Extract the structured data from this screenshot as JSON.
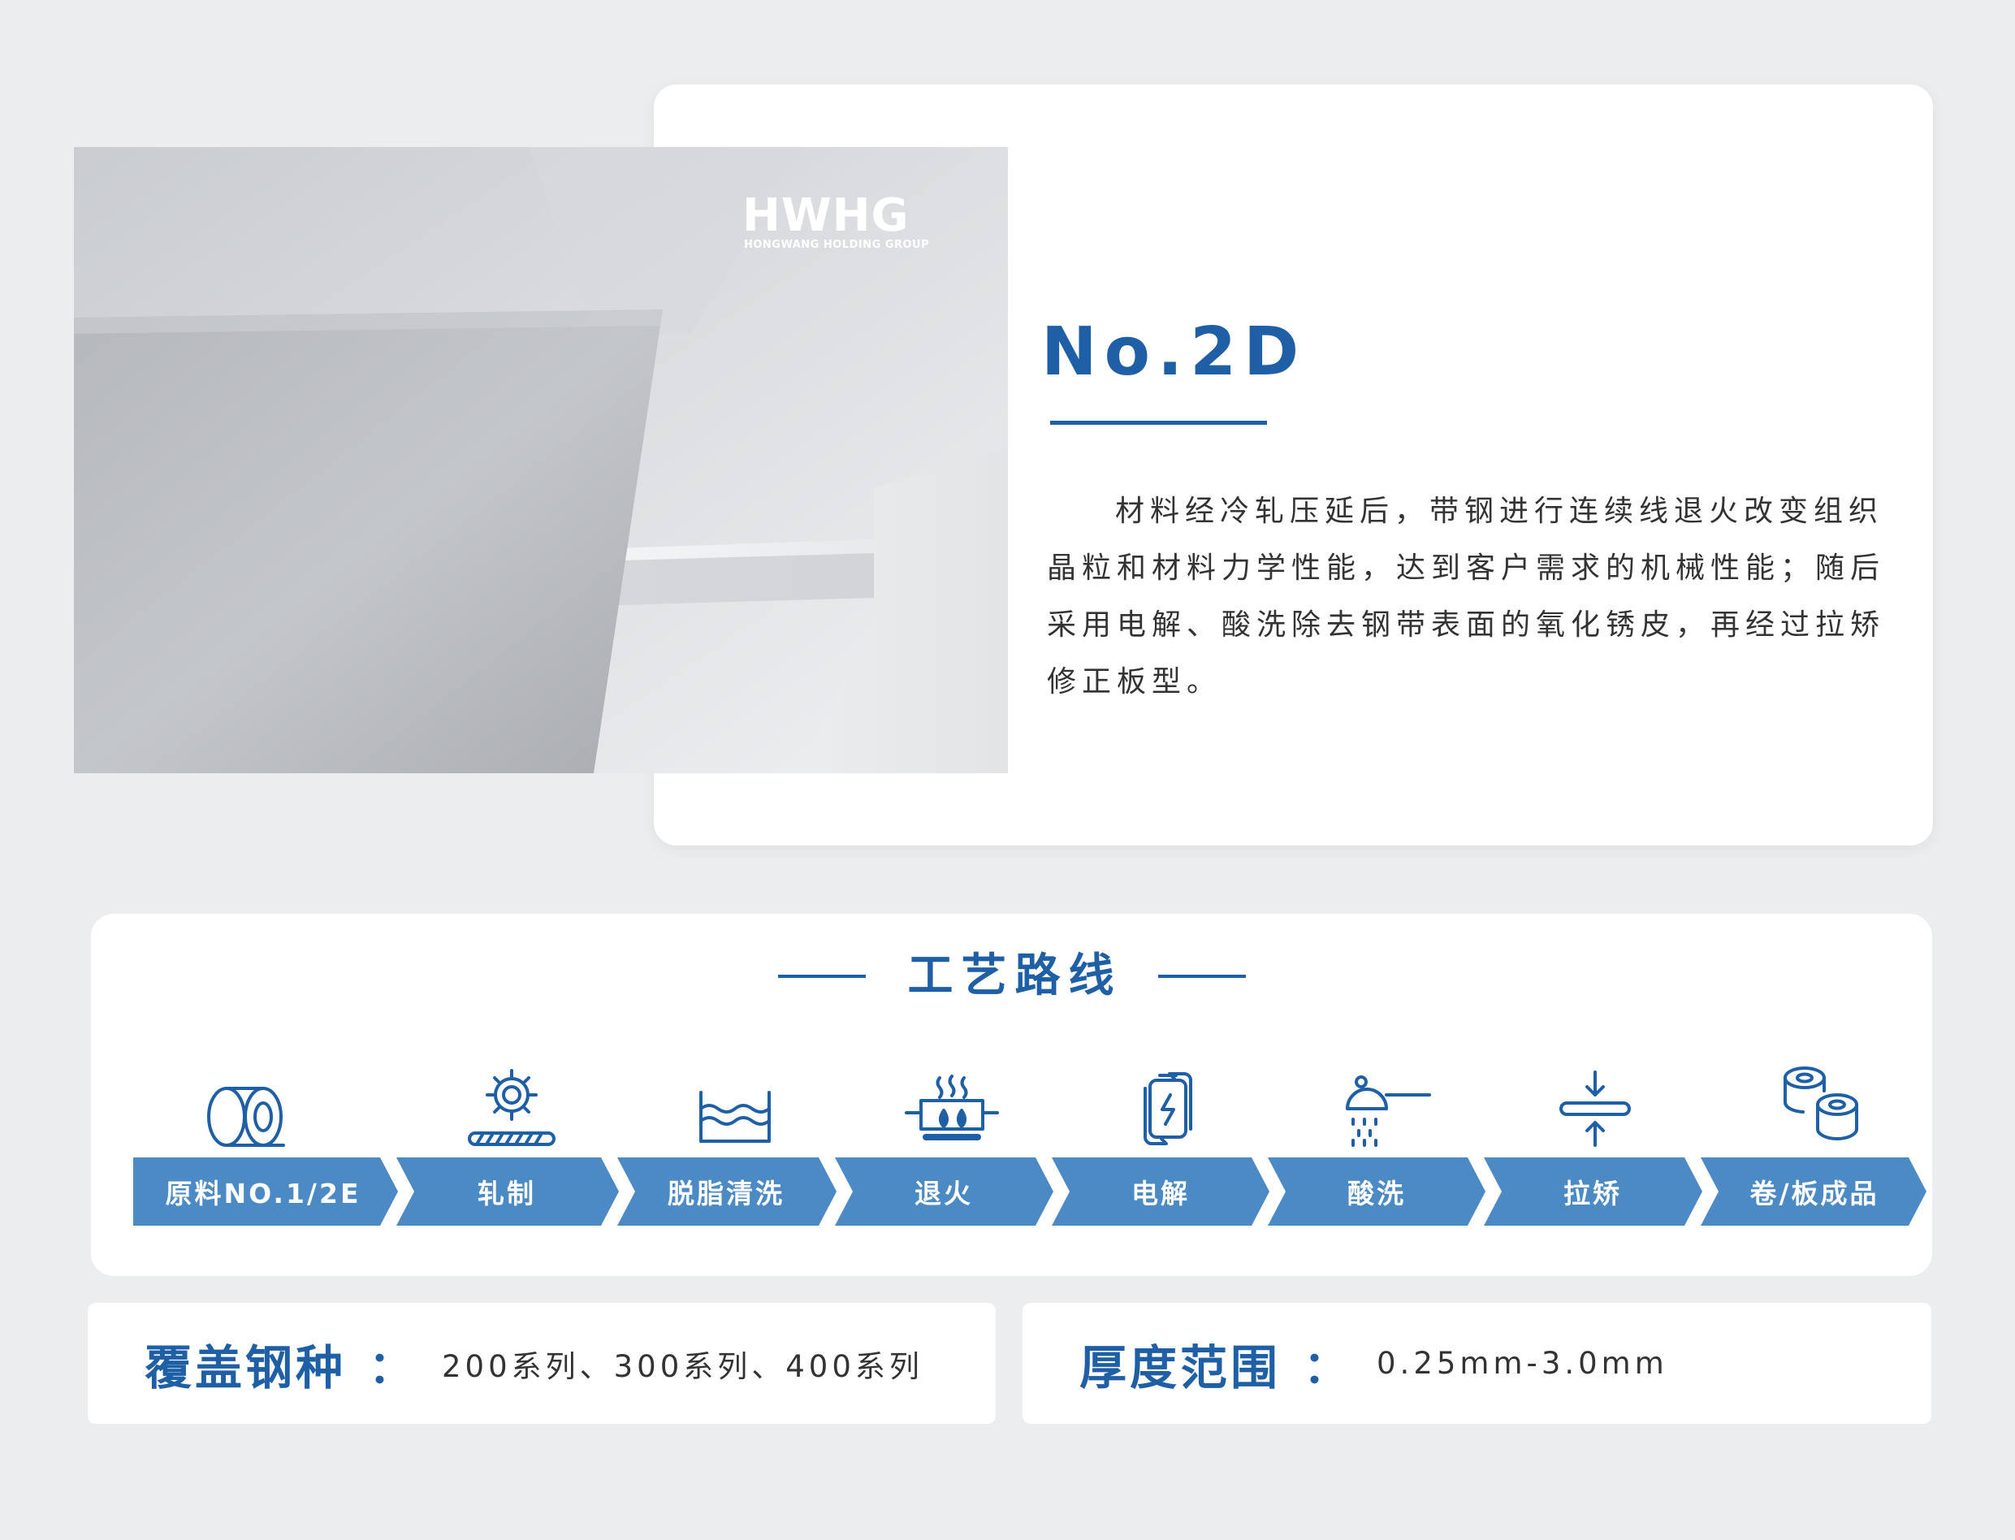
{
  "brand": {
    "logo_text": "HWHG",
    "logo_subtext": "HONGWANG HOLDING GROUP"
  },
  "product": {
    "grade": "No.2D",
    "description": "材料经冷轧压延后，带钢进行连续线退火改变组织晶粒和材料力学性能，达到客户需求的机械性能；随后采用电解、酸洗除去钢带表面的氧化锈皮，再经过拉矫修正板型。"
  },
  "process": {
    "title": "工艺路线",
    "steps": [
      {
        "label": "原料NO.1/2E",
        "icon": "coil-icon"
      },
      {
        "label": "轧制",
        "icon": "gear-rolling-icon"
      },
      {
        "label": "脱脂清洗",
        "icon": "water-bath-icon"
      },
      {
        "label": "退火",
        "icon": "furnace-flame-icon"
      },
      {
        "label": "电解",
        "icon": "battery-cycle-icon"
      },
      {
        "label": "酸洗",
        "icon": "acid-shower-icon"
      },
      {
        "label": "拉矫",
        "icon": "press-straighten-icon"
      },
      {
        "label": "卷/板成品",
        "icon": "finished-coils-icon"
      }
    ]
  },
  "specs": {
    "steel_grades": {
      "label": "覆盖钢种",
      "colon": "：",
      "value": "200系列、300系列、400系列"
    },
    "thickness": {
      "label": "厚度范围",
      "colon": "：",
      "value": "0.25mm-3.0mm"
    }
  },
  "colors": {
    "accent": "#1f5fa6",
    "arrow": "#4c8ac5",
    "background": "#ecedee"
  }
}
